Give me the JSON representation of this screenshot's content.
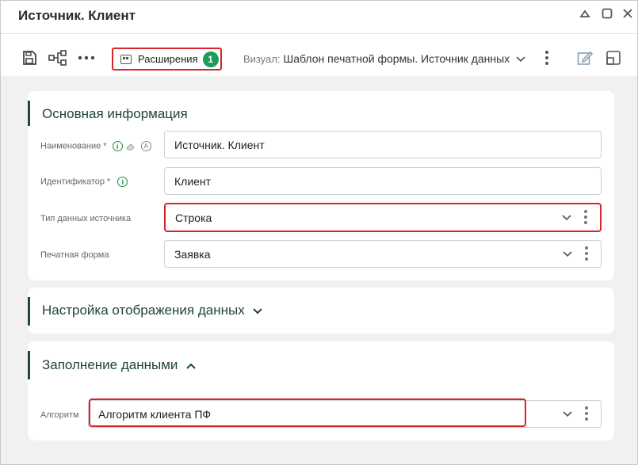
{
  "window": {
    "title": "Источник. Клиент"
  },
  "toolbar": {
    "extensions_label": "Расширения",
    "extensions_count": "1",
    "visual_prefix": "Визуал:",
    "visual_value": "Шаблон печатной формы. Источник данных"
  },
  "main_info": {
    "title": "Основная информация",
    "fields": [
      {
        "label": "Наименование *",
        "value": "Источник. Клиент"
      },
      {
        "label": "Идентификатор *",
        "value": "Клиент"
      },
      {
        "label": "Тип данных источника",
        "value": "Строка"
      },
      {
        "label": "Печатная форма",
        "value": "Заявка"
      }
    ]
  },
  "display_settings": {
    "title": "Настройка отображения данных"
  },
  "data_fill": {
    "title": "Заполнение данными",
    "algorithm_label": "Алгоритм",
    "algorithm_value": "Алгоритм клиента ПФ"
  },
  "colors": {
    "accent_green": "#1b9e5a",
    "highlight_red": "#d9232d",
    "heading": "#1e4535"
  },
  "icons": [
    "save-icon",
    "share-icon",
    "more-icon",
    "extensions-icon",
    "chevron-down-icon",
    "kebab-icon",
    "edit-icon",
    "layout-icon",
    "minimize-icon",
    "maximize-icon",
    "close-icon",
    "info-icon",
    "eraser-icon",
    "auto-icon",
    "chevron-up-icon"
  ]
}
